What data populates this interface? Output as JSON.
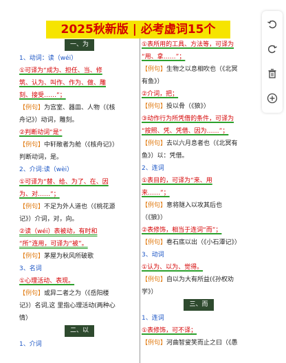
{
  "title": "2025秋新版 | 必考虚词15个",
  "left": {
    "banner1": "一、为",
    "l1a": "1、动词：读（wéi）",
    "l1b": "①可译为“成为、担任、当、修",
    "l1c": "筑、认为、叫作、作为、做、雕",
    "l1d": "刻、接受……”；",
    "l1e_tag": "【例句】",
    "l1e": "为宫室、器皿、人物（《核",
    "l1f": "舟记》）动词，雕刻。",
    "l1g": "②判断动词“是”",
    "l1h_tag": "【例句】",
    "l1h": "中轩敞者为舱（《核舟记》）",
    "l1i": "判断动词，是。",
    "l2a": "2、介词:读（wèi）",
    "l2b": "①可译为“替、给、为了、在、因",
    "l2c": "为、对……”；",
    "l2d_tag": "【例句】",
    "l2d": "不足为外人道也（《桃花源",
    "l2e": "记》）介词，对，向。",
    "l2f": "②读（wéi）表被动，有时和",
    "l2g": "“所”连用，可译为“被”。",
    "l2h_tag": "【例句】",
    "l2h": "茅屋为秋风所破歌",
    "l3a": "3、名词",
    "l3b": "①心理活动、表现。",
    "l3c_tag": "【例句】",
    "l3c": "或异二者之为（《岳阳楼",
    "l3d": "记》）名词,这 里指心理活动(两种心",
    "l3e": "情）",
    "banner2": "二、以",
    "l4a": "1、介词"
  },
  "right": {
    "r1a": "①表所用的工具、方法等，可译为",
    "r1b": "“用、拿……”；",
    "r1c_tag": "【例句】",
    "r1c": "生物之以息相吹也（《北冥",
    "r1d": "有鱼》）",
    "r1e": "②介词，把；",
    "r1f_tag": "【例句】",
    "r1f": "投以骨（《狼》）",
    "r1g": "③动作行为所凭借的条件，可译为",
    "r1h": "“按照、凭、凭借、因为……”；",
    "r1i_tag": "【例句】",
    "r1i": "去以六月息者也（《北冥有",
    "r1j": "鱼》）以：凭借。",
    "r2a": "2、连词",
    "r2b": "①表目的，可译为“来、用",
    "r2c": "来……”；",
    "r2d_tag": "【例句】",
    "r2d": "意将隧入以攻其后也",
    "r2e": "（《狼》）",
    "r2f": "②表修饰，相当于连词“而”；",
    "r2g_tag": "【例句】",
    "r2g": "卷石底以出（《小石潭记》）",
    "r3a": "3、动词",
    "r3b": "①认为、以为、觉得。",
    "r3c_tag": "【例句】",
    "r3c": "自以为大有所益(《孙权劝",
    "r3d": "学》）",
    "banner3": "三、而",
    "r4a": "1、连词",
    "r4b": "①表修饰，可不译；",
    "r4c_tag": "【例句】",
    "r4c": "河曲智叟笑而止之曰（《愚"
  },
  "tools": {
    "t1": "undo-icon",
    "t2": "redo-icon",
    "t3": "trash-icon",
    "t4": "add-icon"
  }
}
